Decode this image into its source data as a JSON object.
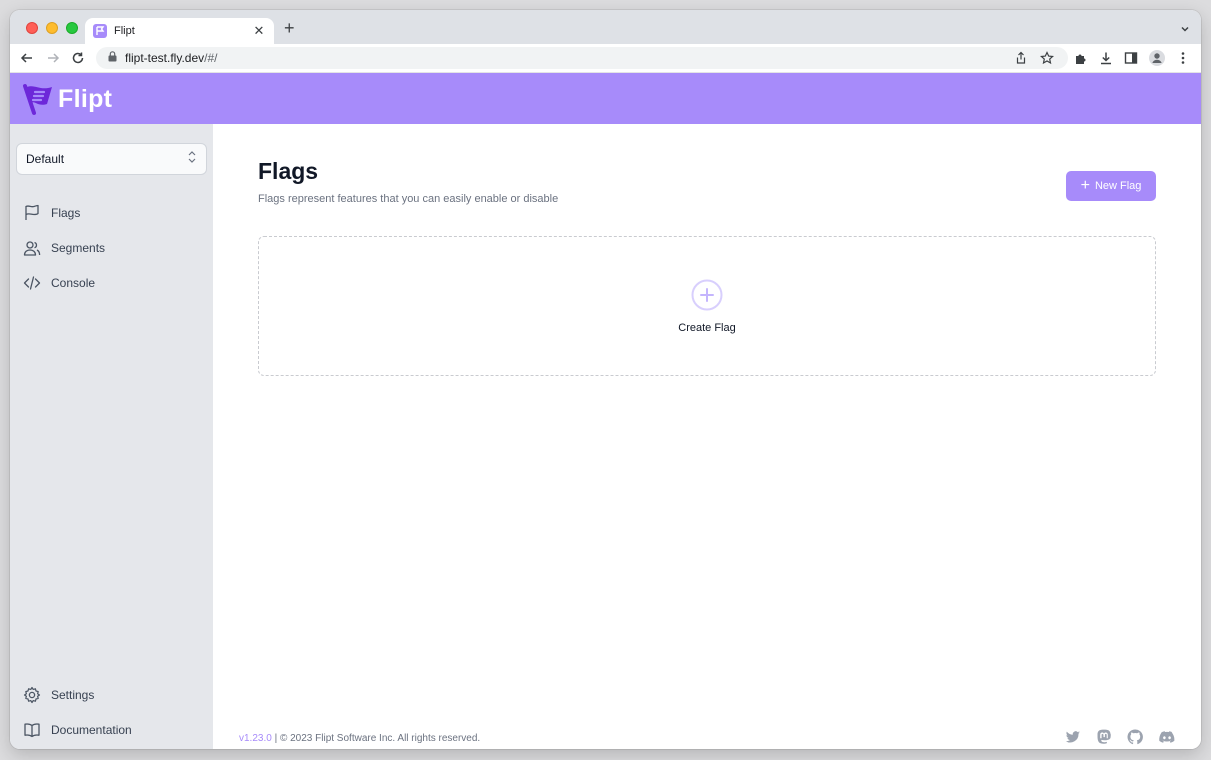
{
  "browser": {
    "tab_title": "Flipt",
    "url_host": "flipt-test.fly.dev",
    "url_path": "/#/"
  },
  "app": {
    "logo_text": "Flipt",
    "brand_color": "#a78bfa"
  },
  "sidebar": {
    "namespace_selected": "Default",
    "nav_items": [
      {
        "label": "Flags",
        "icon": "flag-icon"
      },
      {
        "label": "Segments",
        "icon": "users-icon"
      },
      {
        "label": "Console",
        "icon": "code-icon"
      }
    ],
    "bottom_items": [
      {
        "label": "Settings",
        "icon": "gear-icon"
      },
      {
        "label": "Documentation",
        "icon": "book-icon"
      }
    ]
  },
  "main": {
    "title": "Flags",
    "subtitle": "Flags represent features that you can easily enable or disable",
    "new_button_label": "New Flag",
    "empty_action_label": "Create Flag"
  },
  "footer": {
    "version": "v1.23.0",
    "copyright": " | © 2023 Flipt Software Inc. All rights reserved.",
    "social_icons": [
      "twitter-icon",
      "mastodon-icon",
      "github-icon",
      "discord-icon"
    ]
  }
}
